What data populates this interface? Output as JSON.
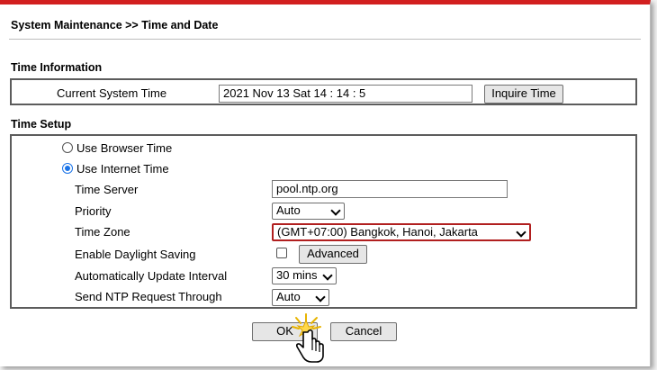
{
  "breadcrumb": "System Maintenance >> Time and Date",
  "time_information": {
    "title": "Time Information",
    "current_time_label": "Current System Time",
    "current_time_value": "2021 Nov 13 Sat 14 : 14 : 5",
    "inquire_button": "Inquire Time"
  },
  "time_setup": {
    "title": "Time Setup",
    "use_browser_time": "Use Browser Time",
    "use_internet_time": "Use Internet Time",
    "selected_mode": "internet",
    "time_server_label": "Time Server",
    "time_server_value": "pool.ntp.org",
    "priority_label": "Priority",
    "priority_value": "Auto",
    "time_zone_label": "Time Zone",
    "time_zone_value": "(GMT+07:00) Bangkok, Hanoi, Jakarta",
    "daylight_label": "Enable Daylight Saving",
    "advanced_button": "Advanced",
    "update_interval_label": "Automatically Update Interval",
    "update_interval_value": "30 mins",
    "ntp_through_label": "Send NTP Request Through",
    "ntp_through_value": "Auto"
  },
  "actions": {
    "ok": "OK",
    "cancel": "Cancel"
  },
  "colors": {
    "accent_red": "#d21f1f",
    "timezone_border": "#b11f1f",
    "radio_blue": "#1a73e8"
  }
}
